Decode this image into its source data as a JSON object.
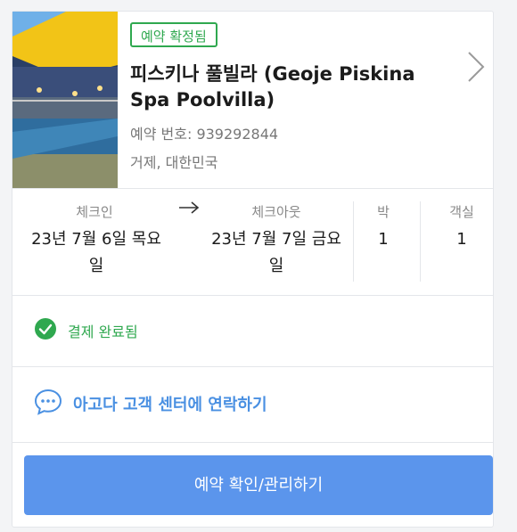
{
  "booking": {
    "status_badge": "예약 확정됨",
    "hotel_name": "피스키나 풀빌라 (Geoje Piskina Spa Poolvilla)",
    "booking_number": "예약 번호: 939292844",
    "location": "거제, 대한민국"
  },
  "stay": {
    "checkin_label": "체크인",
    "checkin_line1": "23년 7월 6일 목요",
    "checkin_line2": "일",
    "checkout_label": "체크아웃",
    "checkout_line1": "23년 7월 7일 금요",
    "checkout_line2": "일",
    "nights_label": "박",
    "nights_value": "1",
    "rooms_label": "객실",
    "rooms_value": "1"
  },
  "payment": {
    "status": "결제 완료됨"
  },
  "contact": {
    "label": "아고다 고객 센터에 연락하기"
  },
  "actions": {
    "manage_label": "예약 확인/관리하기"
  },
  "colors": {
    "success": "#2fa84f",
    "accent": "#4a90e2",
    "button": "#5b95ec"
  },
  "icons": [
    "chevron-right-icon",
    "arrow-right-icon",
    "check-circle-icon",
    "chat-bubble-icon"
  ]
}
